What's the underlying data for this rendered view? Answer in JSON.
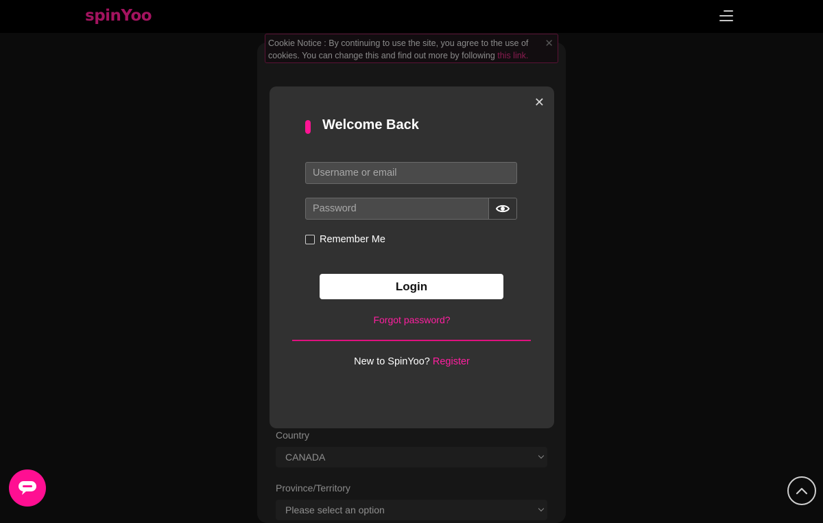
{
  "header": {
    "logo_text": "spinYoo",
    "menu_icon": "hamburger-menu-icon"
  },
  "cookie_notice": {
    "text": "Cookie Notice : By continuing to use the site, you agree to the use of cookies. You can change this and find out more by following ",
    "link_text": "this link.",
    "close_icon": "close-icon"
  },
  "login_modal": {
    "title": "Welcome Back",
    "username_placeholder": "Username or email",
    "password_placeholder": "Password",
    "show_password_icon": "eye-icon",
    "remember_label": "Remember Me",
    "remember_checked": false,
    "login_label": "Login",
    "forgot_label": "Forgot password?",
    "new_prefix": "New to SpinYoo?",
    "register_label": "Register",
    "close_icon": "close-icon"
  },
  "background_form": {
    "country_label": "Country",
    "country_value": "CANADA",
    "province_label": "Province/Territory",
    "province_value": "Please select an option"
  },
  "colors": {
    "accent": "#ff1493",
    "modal_bg": "#313131",
    "page_bg": "#0b0b0b"
  },
  "floating": {
    "chat_icon": "chat-bubble-icon",
    "scroll_top_icon": "chevron-up-icon"
  }
}
